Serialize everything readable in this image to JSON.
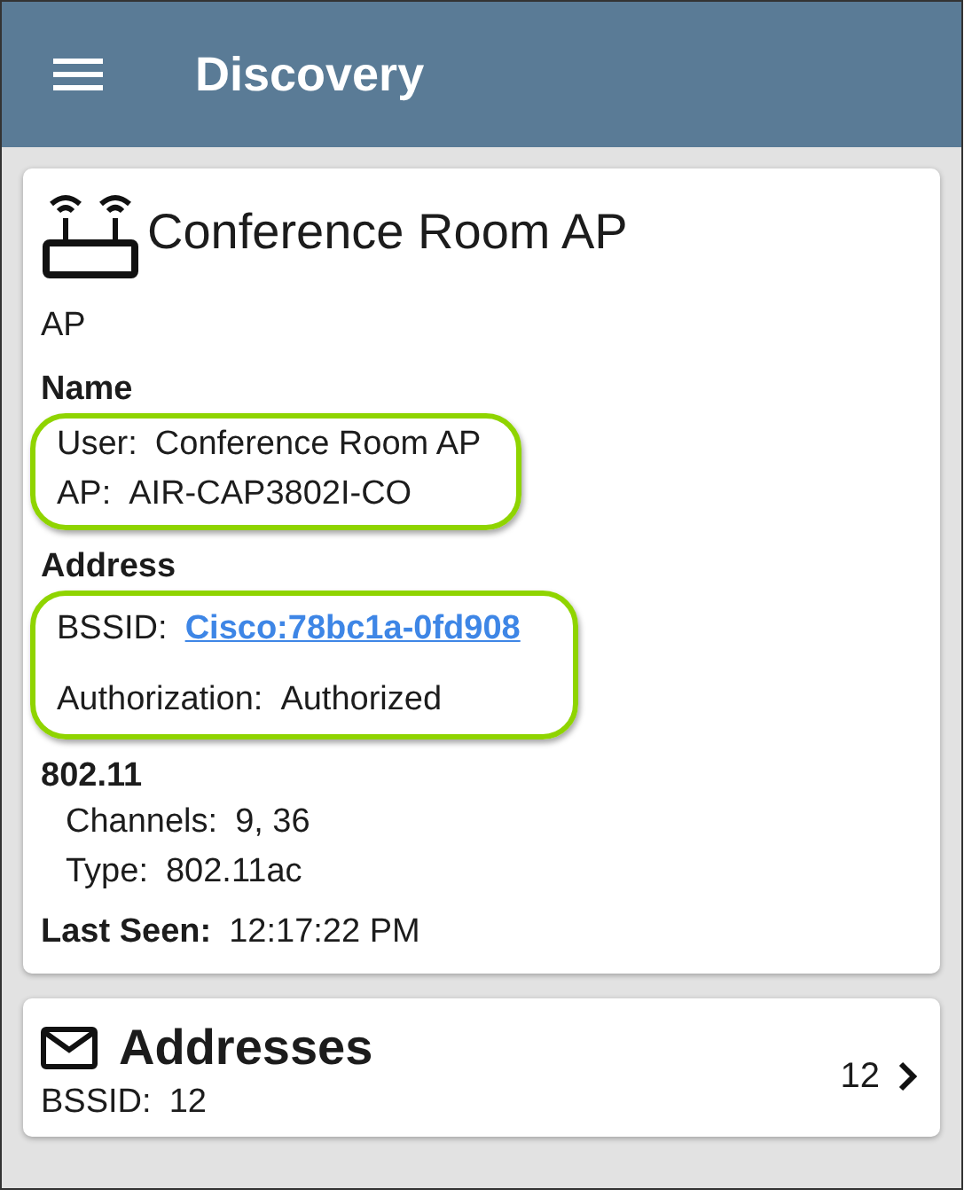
{
  "header": {
    "title": "Discovery"
  },
  "device_card": {
    "title": "Conference Room AP",
    "type": "AP",
    "sections": [
      {
        "heading": "Name",
        "highlighted": true,
        "rows": [
          {
            "label": "User:",
            "value": "Conference Room AP",
            "kind": "text"
          },
          {
            "label": "AP:",
            "value": "AIR-CAP3802I-CO",
            "kind": "text"
          }
        ]
      },
      {
        "heading": "Address",
        "highlighted": true,
        "rows": [
          {
            "label": "BSSID:",
            "value": "Cisco:78bc1a-0fd908",
            "kind": "link"
          },
          {
            "label": "Authorization:",
            "value": "Authorized",
            "kind": "text"
          }
        ]
      },
      {
        "heading": "802.11",
        "highlighted": false,
        "rows": [
          {
            "label": "Channels:",
            "value": "9, 36",
            "kind": "text"
          },
          {
            "label": "Type:",
            "value": "802.11ac",
            "kind": "text"
          }
        ]
      }
    ],
    "last_seen": {
      "label": "Last Seen:",
      "value": "12:17:22 PM"
    }
  },
  "addresses_card": {
    "title": "Addresses",
    "detail_label": "BSSID:",
    "detail_value": "12",
    "count": "12"
  }
}
